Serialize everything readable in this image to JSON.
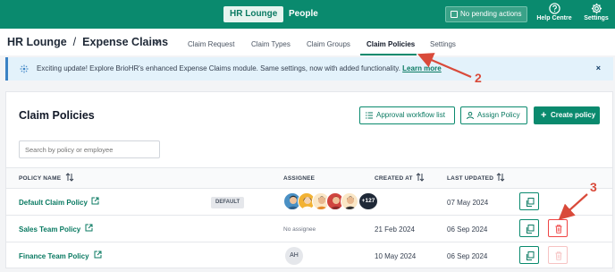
{
  "topbar": {
    "tabs": [
      "HR Lounge",
      "People"
    ],
    "pending_label": "No pending actions",
    "help_label": "Help Centre",
    "settings_label": "Settings"
  },
  "subheader": {
    "breadcrumb_root": "HR Lounge",
    "breadcrumb_sep": "/",
    "breadcrumb_current": "Expense Claims",
    "tabs": [
      "Claim Request",
      "Claim Types",
      "Claim Groups",
      "Claim Policies",
      "Settings"
    ],
    "active_tab": "Claim Policies"
  },
  "banner": {
    "text": "Exciting update! Explore BrioHR's enhanced Expense Claims module. Same settings, now with added functionality.",
    "link": "Learn more",
    "close": "×"
  },
  "card": {
    "title": "Claim Policies",
    "approval_button": "Approval workflow list",
    "assign_button": "Assign Policy",
    "create_button": "Create policy",
    "search_placeholder": "Search by policy or employee",
    "columns": [
      "POLICY NAME",
      "ASSIGNEE",
      "CREATED AT",
      "LAST UPDATED"
    ],
    "rows": [
      {
        "name": "Default Claim Policy",
        "badge": "DEFAULT",
        "assignee_more": "+127",
        "created": "",
        "updated": "07 May 2024"
      },
      {
        "name": "Sales Team Policy",
        "assignee_text": "No assignee",
        "created": "21 Feb 2024",
        "updated": "06 Sep 2024"
      },
      {
        "name": "Finance Team Policy",
        "assignee_initials": "AH",
        "created": "10 May 2024",
        "updated": "06 Sep 2024"
      }
    ]
  },
  "annotations": [
    "2",
    "3"
  ],
  "colors": {
    "brand": "#0a8a6e",
    "danger": "#ef4444",
    "annotation": "#d94a3a",
    "banner_bg": "#e3f2fb"
  }
}
